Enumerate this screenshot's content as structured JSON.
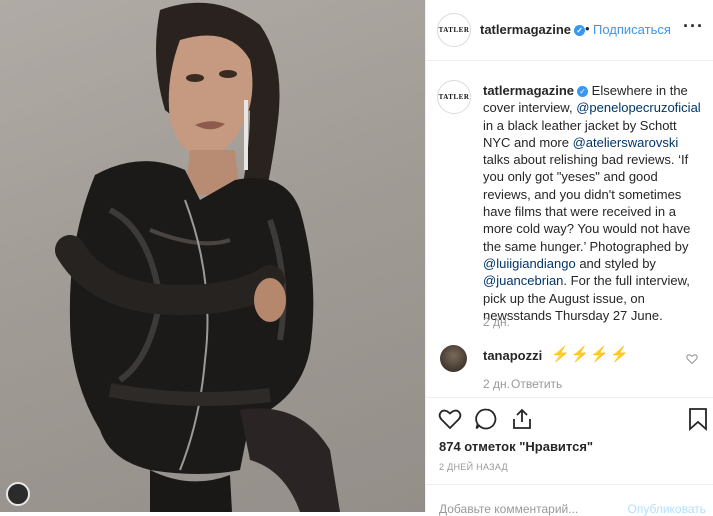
{
  "post": {
    "username": "tatlermagazine",
    "follow_label": "Подписаться",
    "separator": "•",
    "more_label": "···",
    "avatar_text": "TATLER"
  },
  "caption": {
    "username": "tatlermagazine",
    "parts": [
      {
        "text": "Elsewhere in the cover interview, ",
        "mention": false
      },
      {
        "text": "@penelopecruzoficial",
        "mention": true
      },
      {
        "text": " in a black leather jacket by Schott NYC and more ",
        "mention": false
      },
      {
        "text": "@atelierswarovski",
        "mention": true
      },
      {
        "text": " talks about relishing bad reviews. ‘If you only got \"yeses\" and good reviews, and you didn't sometimes have films that were received in a more cold way? You would not have the same hunger.’ Photographed by ",
        "mention": false
      },
      {
        "text": "@luiigiandiango",
        "mention": true
      },
      {
        "text": " and styled by ",
        "mention": false
      },
      {
        "text": "@juancebrian",
        "mention": true
      },
      {
        "text": ". For the full interview, pick up the August issue, on newsstands Thursday 27 June.",
        "mention": false
      }
    ],
    "time": "2 дн."
  },
  "reply": {
    "username": "tanapozzi",
    "text": "⚡⚡⚡⚡",
    "time": "2 дн.",
    "reply_label": "Ответить"
  },
  "stats": {
    "likes": "874 отметок \"Нравится\"",
    "date": "2 ДНЕЙ НАЗАД"
  },
  "comment_box": {
    "placeholder": "Добавьте комментарий...",
    "publish_label": "Опубликовать"
  },
  "icons": [
    "heart-icon",
    "comment-icon",
    "share-icon",
    "bookmark-icon",
    "verified-icon",
    "more-icon"
  ],
  "colors": {
    "accent": "#3897f0",
    "mention": "#003569",
    "muted": "#999999",
    "publish_disabled": "#b2dffc"
  }
}
